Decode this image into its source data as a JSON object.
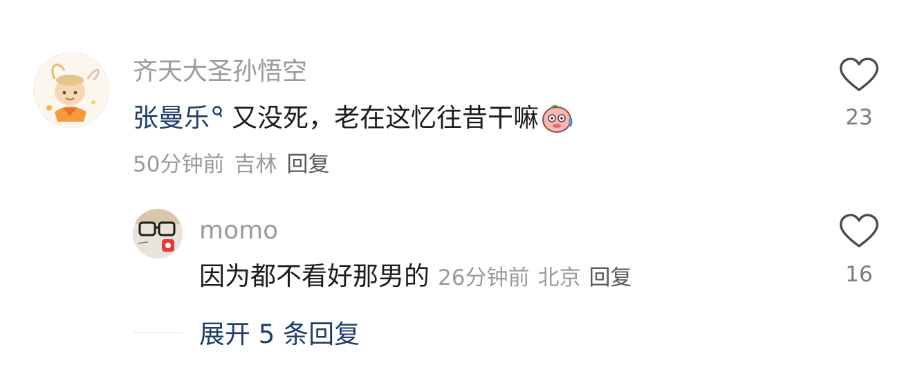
{
  "comment": {
    "username": "齐天大圣孙悟空",
    "mention": "张曼乐",
    "text": "又没死，老在这忆往昔干嘛",
    "emoji": "sweat-face-emoji",
    "time": "50分钟前",
    "location": "吉林",
    "reply_label": "回复",
    "like_count": "23",
    "like_icon": "heart-outline-icon"
  },
  "reply": {
    "username": "momo",
    "text": "因为都不看好那男的",
    "time": "26分钟前",
    "location": "北京",
    "reply_label": "回复",
    "like_count": "16",
    "like_icon": "heart-outline-icon"
  },
  "expand": {
    "label": "展开 5 条回复"
  },
  "colors": {
    "link_blue": "#1f3d6b",
    "meta_gray": "#9a9a9a",
    "text": "#1b1b1b"
  }
}
